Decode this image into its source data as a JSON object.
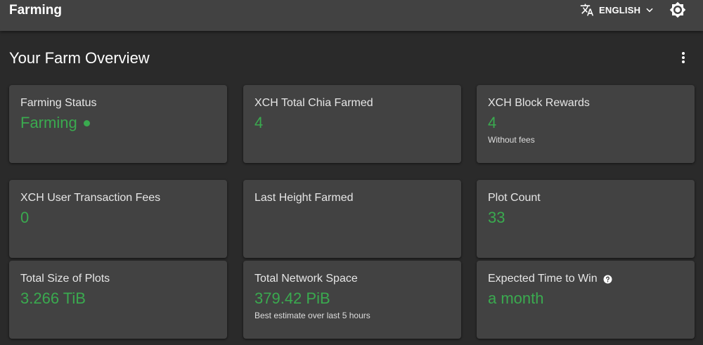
{
  "header": {
    "title": "Farming",
    "language_label": "ENGLISH",
    "icons": [
      "translate-icon",
      "chevron-down-icon",
      "brightness-icon"
    ]
  },
  "page": {
    "title": "Your Farm Overview",
    "menu_icon": "more-vert-icon"
  },
  "cards": {
    "farming_status": {
      "title": "Farming Status",
      "value": "Farming"
    },
    "total_chia_farmed": {
      "title": "XCH Total Chia Farmed",
      "value": "4"
    },
    "block_rewards": {
      "title": "XCH Block Rewards",
      "value": "4",
      "subtitle": "Without fees"
    },
    "user_fees": {
      "title": "XCH User Transaction Fees",
      "value": "0"
    },
    "last_height": {
      "title": "Last Height Farmed",
      "value": ""
    },
    "plot_count": {
      "title": "Plot Count",
      "value": "33"
    },
    "total_size": {
      "title": "Total Size of Plots",
      "value": "3.266 TiB"
    },
    "network_space": {
      "title": "Total Network Space",
      "value": "379.42 PiB",
      "subtitle": "Best estimate over last 5 hours"
    },
    "expected_time": {
      "title": "Expected Time to Win",
      "value": "a month"
    }
  },
  "colors": {
    "accent_green": "#3aaa4f",
    "background": "#2a2a2a",
    "surface": "#424242"
  }
}
